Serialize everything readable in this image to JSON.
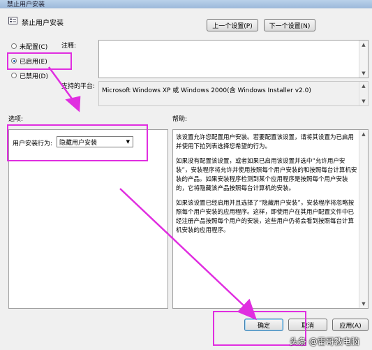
{
  "window": {
    "title": "禁止用户安装"
  },
  "header": {
    "policy_name": "禁止用户安装",
    "prev_label": "上一个设置(P)",
    "next_label": "下一个设置(N)"
  },
  "state": {
    "options": [
      {
        "label": "未配置(C)",
        "selected": false
      },
      {
        "label": "已启用(E)",
        "selected": true
      },
      {
        "label": "已禁用(D)",
        "selected": false
      }
    ]
  },
  "comment": {
    "label": "注释:",
    "value": ""
  },
  "platform": {
    "label": "支持的平台:",
    "value": "Microsoft Windows XP 或 Windows 2000(含 Windows Installer v2.0)"
  },
  "options_panel": {
    "label": "选项:",
    "install_behavior_label": "用户安装行为:",
    "install_behavior_value": "隐藏用户安装"
  },
  "help_panel": {
    "label": "帮助:",
    "paragraphs": [
      "该设置允许您配置用户安装。若要配置该设置，请将其设置为已启用并使用下拉列表选择您希望的行为。",
      "如果没有配置该设置，或者如果已启用该设置并选中“允许用户安装”，安装程序将允许并使用按照每个用户安装的和按照每台计算机安装的产品。如果安装程序检测到某个应用程序是按照每个用户安装的，它将隐藏该产品按照每台计算机的安装。",
      "如果该设置已经启用并且选择了“隐藏用户安装”，安装程序将忽略按照每个用户安装的应用程序。这样，即使用户在其用户配置文件中已经注册产品按照每个用户的安装，这些用户仍将会看到按照每台计算机安装的应用程序。"
    ]
  },
  "footer": {
    "ok_label": "确定",
    "cancel_label": "取消",
    "apply_label": "应用(A)"
  },
  "watermark": "头条 @雷哥教电脑",
  "annotation_color": "#e02ee0"
}
